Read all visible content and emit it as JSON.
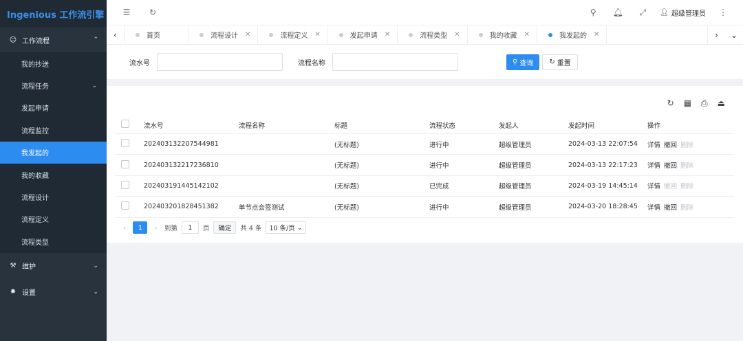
{
  "app": {
    "brand": "Ingenious 工作流引擎"
  },
  "sidebar": {
    "workflow_group": {
      "label": "工作流程"
    },
    "items": [
      {
        "label": "我的抄送"
      },
      {
        "label": "流程任务"
      },
      {
        "label": "发起申请"
      },
      {
        "label": "流程监控"
      },
      {
        "label": "我发起的"
      },
      {
        "label": "我的收藏"
      },
      {
        "label": "流程设计"
      },
      {
        "label": "流程定义"
      },
      {
        "label": "流程类型"
      }
    ],
    "maintain_group": {
      "label": "维护"
    },
    "settings_group": {
      "label": "设置"
    }
  },
  "header": {
    "user_name": "超级管理员"
  },
  "tabs": [
    {
      "label": "首页"
    },
    {
      "label": "流程设计"
    },
    {
      "label": "流程定义"
    },
    {
      "label": "发起申请"
    },
    {
      "label": "流程类型"
    },
    {
      "label": "我的收藏"
    },
    {
      "label": "我发起的"
    }
  ],
  "search": {
    "serial_label": "流水号",
    "serial_value": "",
    "name_label": "流程名称",
    "name_value": "",
    "query_label": "查询",
    "reset_label": "重置"
  },
  "table": {
    "headers": [
      "流水号",
      "流程名称",
      "标题",
      "流程状态",
      "发起人",
      "发起时间",
      "操作"
    ],
    "action_detail": "详情",
    "action_revoke": "撤回",
    "action_delete": "删除",
    "rows": [
      {
        "serial": "202403132207544981",
        "name": "",
        "title": "(无标题)",
        "status": "进行中",
        "initiator": "超级管理员",
        "time": "2024-03-13 22:07:54"
      },
      {
        "serial": "202403132217236810",
        "name": "",
        "title": "(无标题)",
        "status": "进行中",
        "initiator": "超级管理员",
        "time": "2024-03-13 22:17:23"
      },
      {
        "serial": "202403191445142102",
        "name": "",
        "title": "(无标题)",
        "status": "已完成",
        "initiator": "超级管理员",
        "time": "2024-03-19 14:45:14"
      },
      {
        "serial": "202403201828451382",
        "name": "单节点会签测试",
        "title": "(无标题)",
        "status": "进行中",
        "initiator": "超级管理员",
        "time": "2024-03-20 18:28:45"
      }
    ]
  },
  "pagination": {
    "current_page": "1",
    "goto_label": "到第",
    "goto_value": "1",
    "page_unit": "页",
    "confirm_label": "确定",
    "total_label": "共 4 条",
    "page_size": "10 条/页"
  },
  "colors": {
    "primary": "#2d8cf0",
    "sidebar_bg": "#28333e",
    "brand_color": "#3a8ee6"
  }
}
